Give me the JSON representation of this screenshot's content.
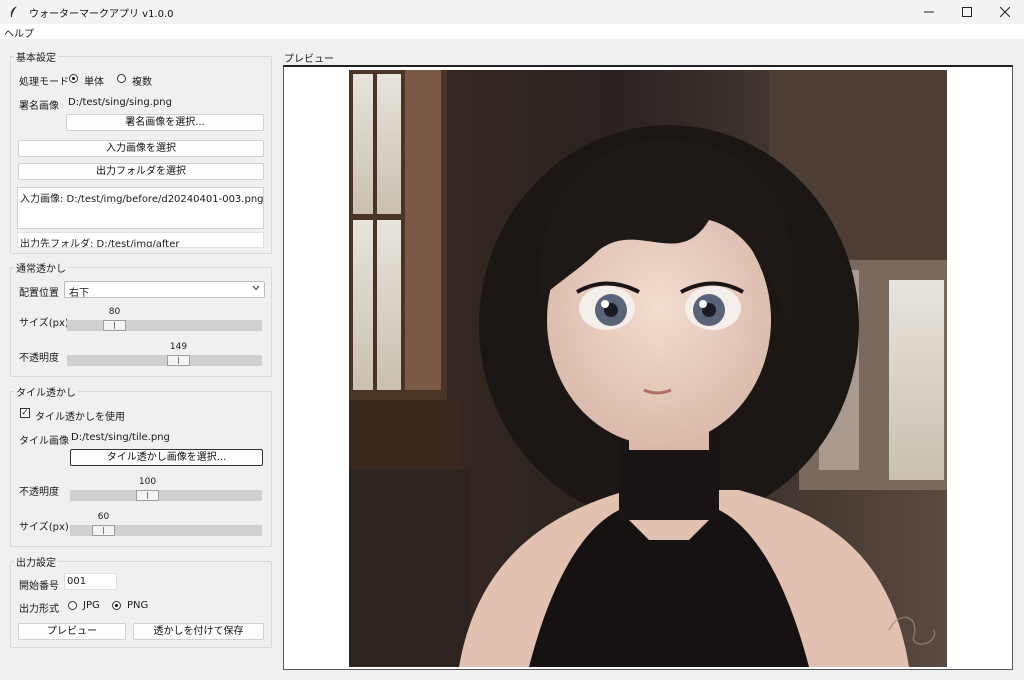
{
  "window": {
    "title": "ウォーターマークアプリ  v1.0.0"
  },
  "menu": {
    "help": "ヘルプ"
  },
  "basic": {
    "group_title": "基本設定",
    "mode_label": "処理モード",
    "mode_single": "単体",
    "mode_multi": "複数",
    "signature_label": "署名画像",
    "signature_path": "D:/test/sing/sing.png",
    "select_signature_button": "署名画像を選択...",
    "select_input_button": "入力画像を選択",
    "select_output_button": "出力フォルダを選択",
    "input_text": "入力画像: D:/test/img/before/d20240401-003.png",
    "output_text": "出力先フォルダ: D:/test/img/after"
  },
  "normal": {
    "group_title": "通常透かし",
    "position_label": "配置位置",
    "position_value": "右下",
    "size_label": "サイズ(px)",
    "size_value": "80",
    "size_fraction": 0.21,
    "opacity_label": "不透明度",
    "opacity_value": "149",
    "opacity_fraction": 0.58
  },
  "tile": {
    "group_title": "タイル透かし",
    "use_tile_label": "タイル透かしを使用",
    "tile_image_label": "タイル画像",
    "tile_image_path": "D:/test/sing/tile.png",
    "select_tile_button": "タイル透かし画像を選択...",
    "opacity_label": "不透明度",
    "opacity_value": "100",
    "opacity_fraction": 0.39,
    "size_label": "サイズ(px)",
    "size_value": "60",
    "size_fraction": 0.13
  },
  "output": {
    "group_title": "出力設定",
    "start_number_label": "開始番号",
    "start_number_value": "001",
    "format_label": "出力形式",
    "format_jpg": "JPG",
    "format_png": "PNG",
    "preview_button": "プレビュー",
    "save_button": "透かしを付けて保存"
  },
  "preview": {
    "label": "プレビュー"
  },
  "colors": {
    "accent": "#1a1a1a",
    "track": "#d0d0d0",
    "background": "#f0f0f0"
  }
}
